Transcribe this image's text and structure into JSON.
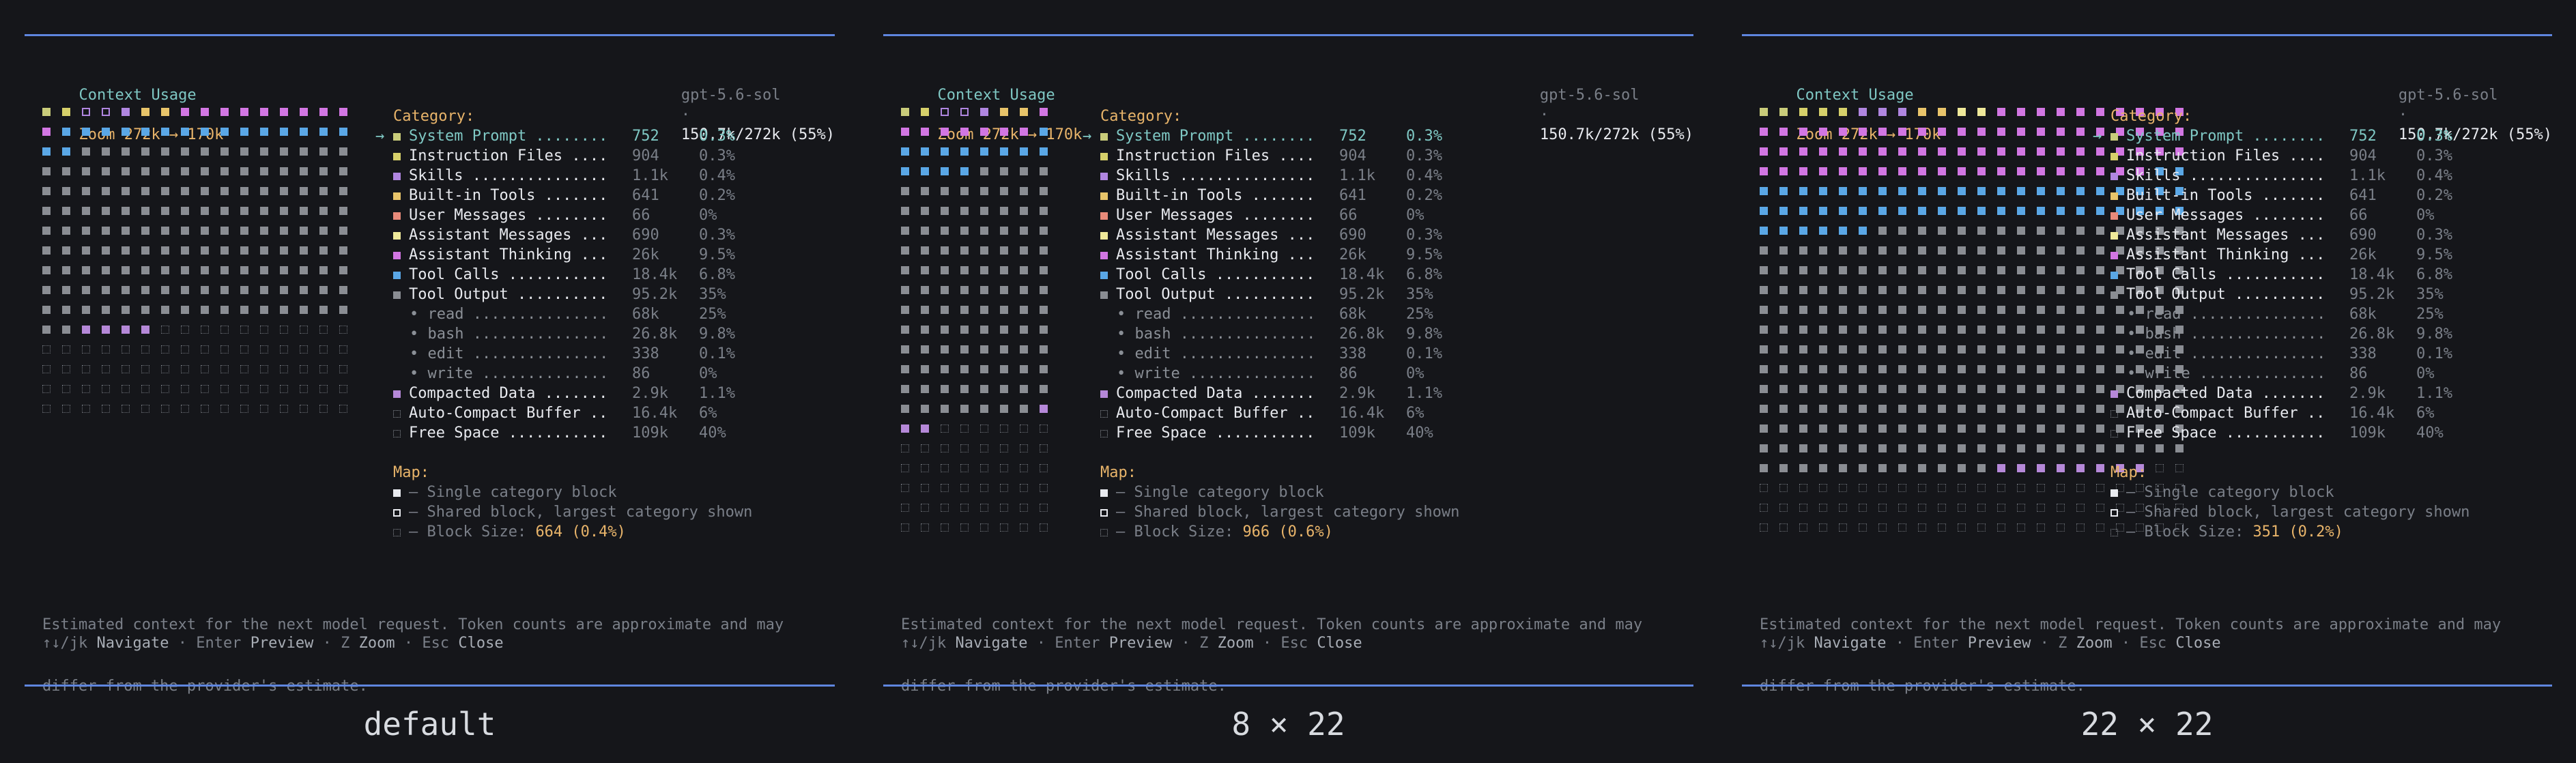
{
  "colors": {
    "system": "#c9cc7a",
    "instructions": "#d6d06a",
    "skills": "#b086e0",
    "builtin": "#e8c46a",
    "user": "#e88a7a",
    "assistant": "#efe99a",
    "thinking": "#d276e3",
    "toolcalls": "#5aa7e6",
    "tooloutput": "#8a8d93",
    "compacted": "#b588d8",
    "free": "#6b6f76"
  },
  "header": {
    "title": "Context Usage",
    "sep": "·",
    "zoom": "Zoom 272k → 170k",
    "model": "gpt-5.6-sol",
    "usage": "150.7k/272k (55%)"
  },
  "category_heading": "Category:",
  "categories": [
    {
      "label": "System Prompt ........",
      "value": "752",
      "pct": "0.3%",
      "color_key": "system",
      "selected": true
    },
    {
      "label": "Instruction Files ....",
      "value": "904",
      "pct": "0.3%",
      "color_key": "instructions"
    },
    {
      "label": "Skills ...............",
      "value": "1.1k",
      "pct": "0.4%",
      "color_key": "skills"
    },
    {
      "label": "Built-in Tools .......",
      "value": "641",
      "pct": "0.2%",
      "color_key": "builtin"
    },
    {
      "label": "User Messages ........",
      "value": "66",
      "pct": "0%",
      "color_key": "user"
    },
    {
      "label": "Assistant Messages ...",
      "value": "690",
      "pct": "0.3%",
      "color_key": "assistant"
    },
    {
      "label": "Assistant Thinking ...",
      "value": "26k",
      "pct": "9.5%",
      "color_key": "thinking"
    },
    {
      "label": "Tool Calls ...........",
      "value": "18.4k",
      "pct": "6.8%",
      "color_key": "toolcalls"
    },
    {
      "label": "Tool Output ..........",
      "value": "95.2k",
      "pct": "35%",
      "color_key": "tooloutput"
    },
    {
      "label": "• read ...............",
      "value": "68k",
      "pct": "25%",
      "sub": true
    },
    {
      "label": "• bash ...............",
      "value": "26.8k",
      "pct": "9.8%",
      "sub": true
    },
    {
      "label": "• edit ...............",
      "value": "338",
      "pct": "0.1%",
      "sub": true
    },
    {
      "label": "• write ..............",
      "value": "86",
      "pct": "0%",
      "sub": true
    },
    {
      "label": "Compacted Data .......",
      "value": "2.9k",
      "pct": "1.1%",
      "color_key": "compacted"
    },
    {
      "label": "Auto-Compact Buffer ..",
      "value": "16.4k",
      "pct": "6%",
      "dotted": true
    },
    {
      "label": "Free Space ...........",
      "value": "109k",
      "pct": "40%",
      "dotted": true
    }
  ],
  "map": {
    "heading": "Map:",
    "single": "– Single category block",
    "shared": "– Shared block, largest category shown",
    "block_size_label": "– Block Size:"
  },
  "footer": {
    "note_line1": "Estimated context for the next model request. Token counts are approximate and may",
    "note_line2": "differ from the provider's estimate.",
    "keys": [
      {
        "key": "↑↓/jk",
        "label": "Navigate"
      },
      {
        "key": "Enter",
        "label": "Preview"
      },
      {
        "key": "Z",
        "label": "Zoom"
      },
      {
        "key": "Esc",
        "label": "Close"
      }
    ]
  },
  "panels": [
    {
      "caption": "default",
      "block_size": "664 (0.4%)",
      "grid": {
        "cols": 16,
        "rows": 16,
        "counts": {
          "system": 1,
          "instructions": 1,
          "shared_a": 2,
          "skills": 1,
          "builtin": 2,
          "thinking": 10,
          "toolcalls": 17,
          "tooloutput": 144,
          "compacted": 4,
          "free": 74
        }
      }
    },
    {
      "caption": "8 × 22",
      "block_size": "966 (0.6%)",
      "grid": {
        "cols": 8,
        "rows": 22,
        "counts": {
          "system": 1,
          "instructions": 1,
          "shared_a": 2,
          "skills": 1,
          "builtin": 2,
          "thinking": 8,
          "toolcalls": 13,
          "tooloutput": 99,
          "compacted": 3,
          "free": 46
        }
      }
    },
    {
      "caption": "22 × 22",
      "block_size": "351 (0.2%)",
      "grid": {
        "cols": 22,
        "rows": 22,
        "counts": {
          "system": 2,
          "instructions": 3,
          "skills": 3,
          "builtin": 2,
          "assistant": 2,
          "thinking": 74,
          "toolcalls": 52,
          "tooloutput": 270,
          "compacted": 8,
          "free": 68
        }
      }
    }
  ]
}
